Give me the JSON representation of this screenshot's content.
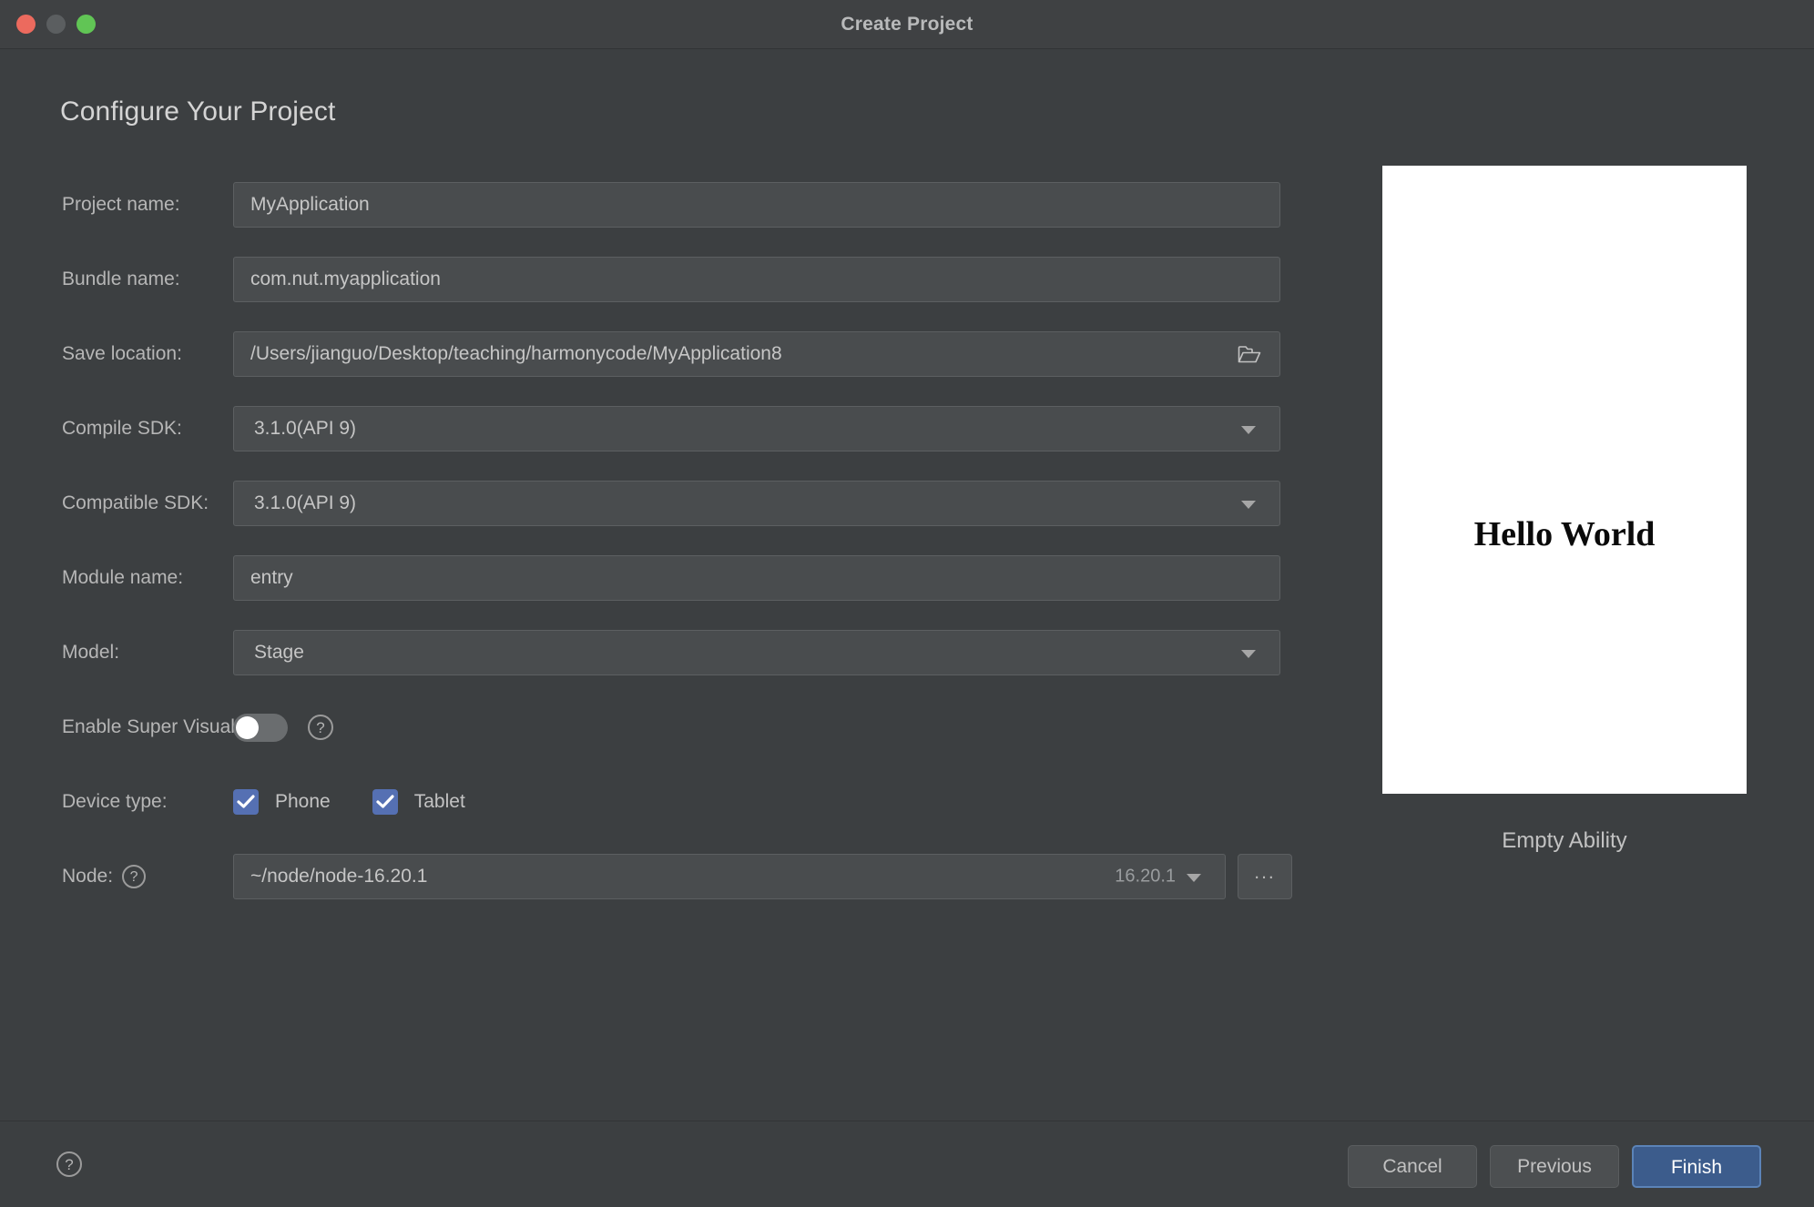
{
  "window": {
    "title": "Create Project",
    "traffic_lights": [
      "close",
      "minimize",
      "maximize"
    ]
  },
  "heading": "Configure Your Project",
  "form": {
    "project_name": {
      "label": "Project name:",
      "value": "MyApplication"
    },
    "bundle_name": {
      "label": "Bundle name:",
      "value": "com.nut.myapplication"
    },
    "save_location": {
      "label": "Save location:",
      "value": "/Users/jianguo/Desktop/teaching/harmonycode/MyApplication8",
      "browse_icon": "folder-icon"
    },
    "compile_sdk": {
      "label": "Compile SDK:",
      "value": "3.1.0(API 9)"
    },
    "compatible_sdk": {
      "label": "Compatible SDK:",
      "value": "3.1.0(API 9)"
    },
    "module_name": {
      "label": "Module name:",
      "value": "entry"
    },
    "model": {
      "label": "Model:",
      "value": "Stage"
    },
    "enable_super_visual": {
      "label": "Enable Super Visual:",
      "state": "off",
      "help": "?"
    },
    "device_type": {
      "label": "Device type:",
      "options": [
        {
          "label": "Phone",
          "checked": true
        },
        {
          "label": "Tablet",
          "checked": true
        }
      ]
    },
    "node": {
      "label": "Node:",
      "help": "?",
      "value": "~/node/node-16.20.1",
      "version": "16.20.1",
      "browse_label": "..."
    }
  },
  "preview": {
    "text": "Hello World",
    "caption": "Empty Ability"
  },
  "footer": {
    "help": "?",
    "cancel": "Cancel",
    "previous": "Previous",
    "finish": "Finish"
  },
  "colors": {
    "window_bg": "#3c3f41",
    "field_bg": "#494c4e",
    "accent_checkbox": "#5570b3",
    "accent_primary_button": "#3c5c8c",
    "close_light": "#ec6a5e",
    "minimize_light": "#5b5e60",
    "maximize_light": "#61c555"
  }
}
